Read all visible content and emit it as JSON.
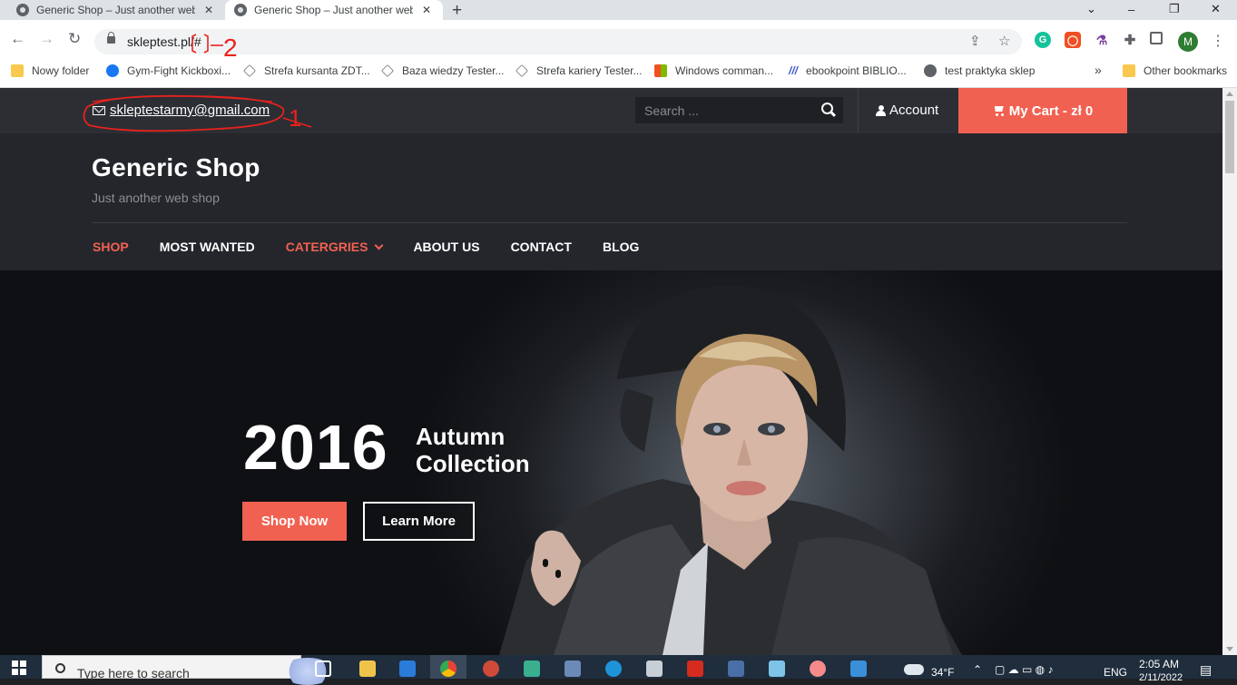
{
  "browser": {
    "tabs": [
      {
        "title": "Generic Shop – Just another web shop",
        "active": false
      },
      {
        "title": "Generic Shop – Just another web shop",
        "active": true
      }
    ],
    "new_tab_label": "+",
    "window_controls": {
      "dropdown": "⌄",
      "minimize": "–",
      "restore": "❐",
      "close": "✕"
    },
    "url": "skleptest.pl/#",
    "nav": {
      "back": "←",
      "forward": "→",
      "reload": "↻"
    },
    "profile_initial": "M",
    "bookmarks": [
      {
        "label": "Nowy folder",
        "icon": "folder-icon"
      },
      {
        "label": "Gym-Fight Kickboxi...",
        "icon": "facebook-icon"
      },
      {
        "label": "Strefa kursanta ZDT...",
        "icon": "zdt-icon"
      },
      {
        "label": "Baza wiedzy Tester...",
        "icon": "zdt-icon"
      },
      {
        "label": "Strefa kariery Tester...",
        "icon": "zdt-icon"
      },
      {
        "label": "Windows comman...",
        "icon": "windows-icon"
      },
      {
        "label": "ebookpoint BIBLIO...",
        "icon": "ebookpoint-icon"
      },
      {
        "label": "test praktyka sklep",
        "icon": "globe-icon"
      }
    ],
    "bookmarks_overflow": "»",
    "other_bookmarks": "Other bookmarks"
  },
  "site": {
    "email": "skleptestarmy@gmail.com",
    "search_placeholder": "Search ...",
    "account_label": "Account",
    "cart_label": "My Cart - zł 0",
    "title": "Generic Shop",
    "tagline": "Just another web shop",
    "nav": [
      {
        "label": "SHOP",
        "highlight": true
      },
      {
        "label": "MOST WANTED",
        "highlight": false
      },
      {
        "label": "CATERGRIES",
        "highlight": true,
        "dropdown": true
      },
      {
        "label": "ABOUT US",
        "highlight": false
      },
      {
        "label": "CONTACT",
        "highlight": false
      },
      {
        "label": "BLOG",
        "highlight": false
      }
    ],
    "hero": {
      "year": "2016",
      "subtitle_line1": "Autumn",
      "subtitle_line2": "Collection",
      "primary_button": "Shop Now",
      "secondary_button": "Learn More"
    }
  },
  "annotations": {
    "mark1": "1",
    "mark2": "2"
  },
  "taskbar": {
    "search_placeholder": "Type here to search",
    "weather": "34°F",
    "language": "ENG",
    "time": "2:05 AM",
    "date": "2/11/2022"
  },
  "colors": {
    "accent": "#f16152",
    "topbar": "#2c2e33",
    "header": "#24262b"
  }
}
